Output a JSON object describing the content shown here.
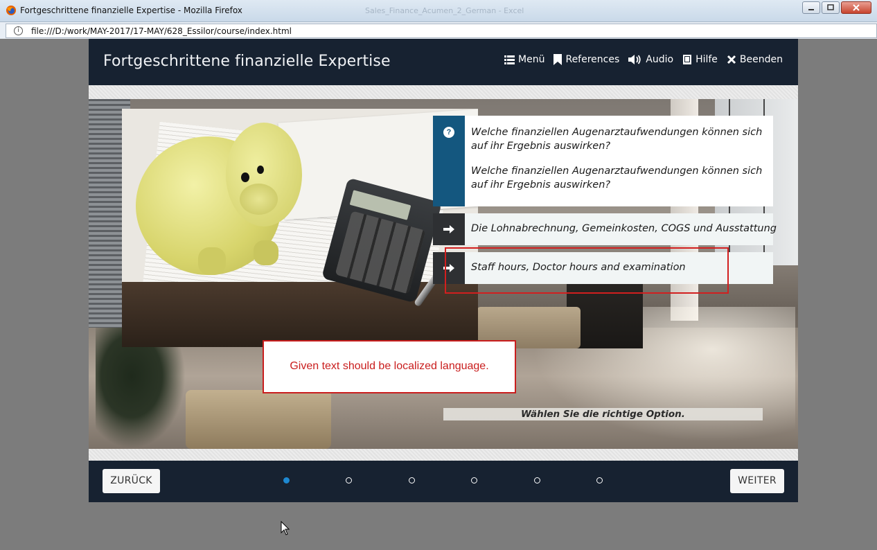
{
  "browser": {
    "window_title": "Fortgeschrittene finanzielle Expertise - Mozilla Firefox",
    "background_title": "Sales_Finance_Acumen_2_German - Excel",
    "url": "file:///D:/work/MAY-2017/17-MAY/628_Essilor/course/index.html"
  },
  "course": {
    "title": "Fortgeschrittene finanzielle Expertise",
    "nav": [
      {
        "label": "Menü",
        "icon": "menu-icon"
      },
      {
        "label": "References",
        "icon": "bookmark-icon"
      },
      {
        "label": "Audio",
        "icon": "speaker-icon"
      },
      {
        "label": "Hilfe",
        "icon": "book-icon"
      },
      {
        "label": "Beenden",
        "icon": "close-icon"
      }
    ]
  },
  "question": {
    "icon": "question-icon",
    "lines": [
      "Welche finanziellen Augenarztaufwendungen können sich auf ihr Ergebnis auswirken?",
      "Welche finanziellen Augenarztaufwendungen können sich auf ihr Ergebnis auswirken?"
    ]
  },
  "options": [
    {
      "label": "Die Lohnabrechnung, Gemeinkosten, COGS und Ausstattung",
      "icon": "arrow-right-icon"
    },
    {
      "label": "Staff hours, Doctor hours and examination",
      "icon": "arrow-right-icon"
    }
  ],
  "review_comment": "Given text should be localized language.",
  "instruction": "Wählen Sie die richtige Option.",
  "footer": {
    "back_label": "ZURÜCK",
    "next_label": "WEITER",
    "pages": 6,
    "current_page": 1
  },
  "colors": {
    "header_bg": "#172231",
    "question_accent": "#14577f",
    "highlight": "#d21f1f",
    "active_dot": "#1e88d0"
  }
}
